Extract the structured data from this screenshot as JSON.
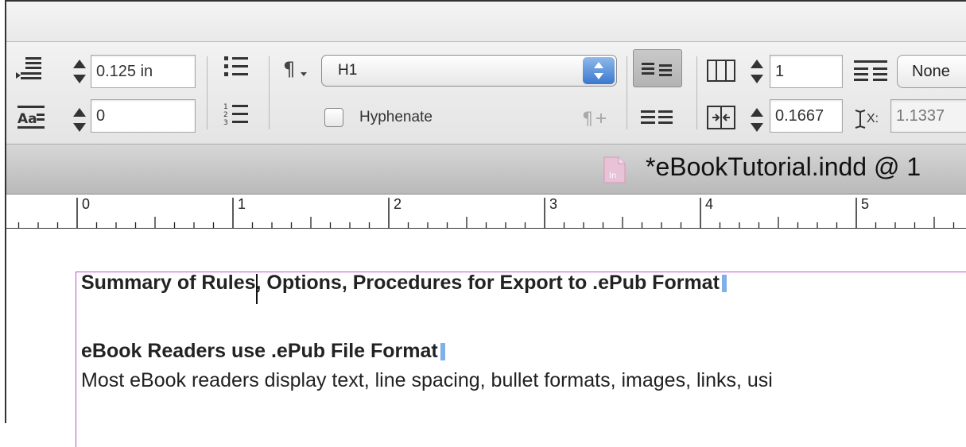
{
  "control_panel": {
    "space_before_value": "0.125 in",
    "drop_cap_lines_value": "0",
    "paragraph_style": "H1",
    "hyphenate_label": "Hyphenate",
    "columns_value": "1",
    "gutter_value": "0.1667",
    "span_label": "None",
    "x_label": "X:",
    "x_value": "1.1337"
  },
  "tab": {
    "document_title": "*eBookTutorial.indd @ 1"
  },
  "ruler": {
    "ticks": [
      "0",
      "1",
      "2",
      "3",
      "4",
      "5"
    ]
  },
  "document": {
    "heading": "Summary of Rules, Options, Procedures for Export to .ePub Format",
    "subheading": "eBook Readers use .ePub File Format",
    "body": "Most eBook readers display text, line spacing, bullet formats, images, links, usi"
  }
}
